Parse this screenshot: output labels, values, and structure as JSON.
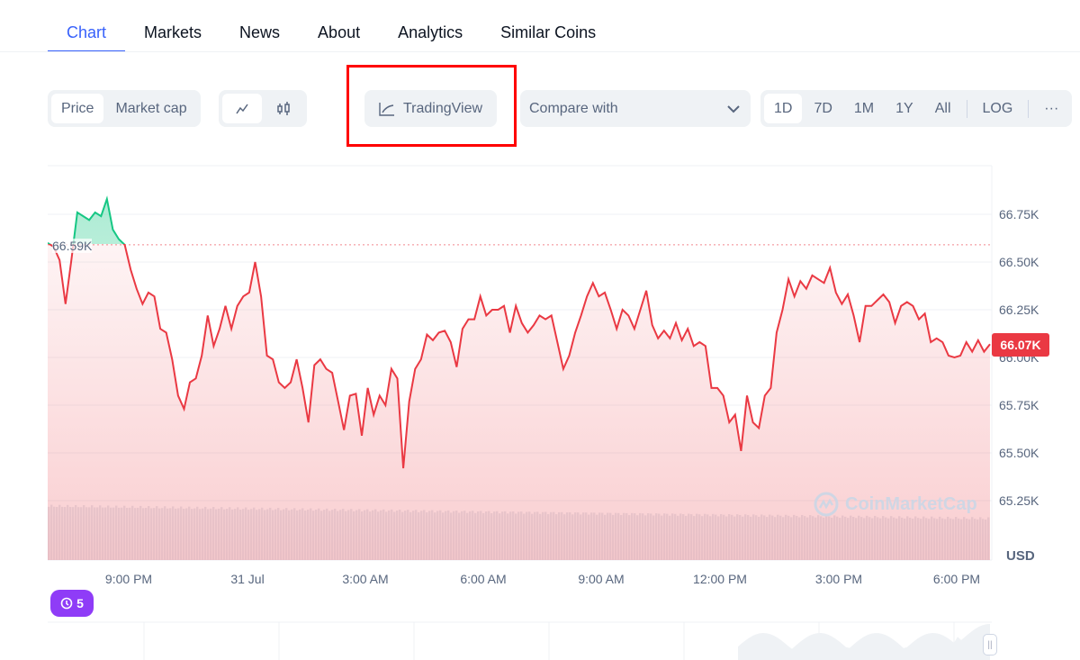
{
  "tabs": [
    {
      "label": "Chart",
      "active": true
    },
    {
      "label": "Markets"
    },
    {
      "label": "News"
    },
    {
      "label": "About"
    },
    {
      "label": "Analytics"
    },
    {
      "label": "Similar Coins"
    }
  ],
  "toolbar": {
    "metric_options": [
      "Price",
      "Market cap"
    ],
    "metric_selected": "Price",
    "chart_type_icons": [
      "line-chart-icon",
      "candlestick-icon"
    ],
    "tradingview_label": "TradingView",
    "compare_placeholder": "Compare with",
    "ranges": [
      "1D",
      "7D",
      "1M",
      "1Y",
      "All"
    ],
    "range_selected": "1D",
    "log_label": "LOG",
    "more_label": "···"
  },
  "colors": {
    "accent": "#3861fb",
    "up": "#16c784",
    "down": "#ea3943",
    "highlight_box": "#ff0000",
    "badge": "#8f3cf7"
  },
  "chart_data": {
    "type": "line",
    "x_ticks": [
      "9:00 PM",
      "31 Jul",
      "3:00 AM",
      "6:00 AM",
      "9:00 AM",
      "12:00 PM",
      "3:00 PM",
      "6:00 PM"
    ],
    "y_ticks": [
      "66.75K",
      "66.50K",
      "66.25K",
      "66.00K",
      "65.75K",
      "65.50K",
      "65.25K"
    ],
    "ylim": [
      65.25,
      66.75
    ],
    "y_unit": "USD",
    "baseline": 66.59,
    "baseline_label": "66.59K",
    "current_label": "66.07K",
    "values": [
      66.6,
      66.58,
      66.51,
      66.28,
      66.51,
      66.76,
      66.74,
      66.72,
      66.76,
      66.74,
      66.83,
      66.67,
      66.62,
      66.59,
      66.46,
      66.36,
      66.28,
      66.34,
      66.32,
      66.15,
      66.13,
      65.99,
      65.8,
      65.73,
      65.87,
      65.89,
      66.01,
      66.22,
      66.06,
      66.15,
      66.27,
      66.15,
      66.27,
      66.32,
      66.34,
      66.5,
      66.32,
      66.01,
      65.99,
      65.87,
      65.84,
      65.87,
      65.99,
      65.84,
      65.66,
      65.96,
      65.99,
      65.94,
      65.92,
      65.77,
      65.62,
      65.8,
      65.81,
      65.59,
      65.84,
      65.7,
      65.8,
      65.75,
      65.94,
      65.89,
      65.42,
      65.77,
      65.94,
      65.99,
      66.12,
      66.09,
      66.13,
      66.14,
      66.08,
      65.95,
      66.15,
      66.2,
      66.2,
      66.32,
      66.22,
      66.25,
      66.25,
      66.27,
      66.13,
      66.27,
      66.18,
      66.13,
      66.17,
      66.22,
      66.2,
      66.22,
      66.08,
      65.94,
      66.01,
      66.13,
      66.22,
      66.32,
      66.39,
      66.32,
      66.34,
      66.25,
      66.15,
      66.25,
      66.22,
      66.15,
      66.25,
      66.35,
      66.17,
      66.1,
      66.14,
      66.1,
      66.18,
      66.09,
      66.15,
      66.06,
      66.08,
      66.06,
      65.84,
      65.84,
      65.8,
      65.66,
      65.7,
      65.51,
      65.8,
      65.66,
      65.63,
      65.8,
      65.84,
      66.13,
      66.25,
      66.41,
      66.32,
      66.4,
      66.36,
      66.43,
      66.41,
      66.39,
      66.47,
      66.34,
      66.28,
      66.33,
      66.22,
      66.08,
      66.27,
      66.27,
      66.3,
      66.33,
      66.29,
      66.18,
      66.27,
      66.29,
      66.27,
      66.2,
      66.23,
      66.08,
      66.1,
      66.08,
      66.01,
      66.0,
      66.01,
      66.08,
      66.03,
      66.09,
      66.03,
      66.07
    ]
  },
  "badge_count": "5",
  "watermark": "CoinMarketCap"
}
